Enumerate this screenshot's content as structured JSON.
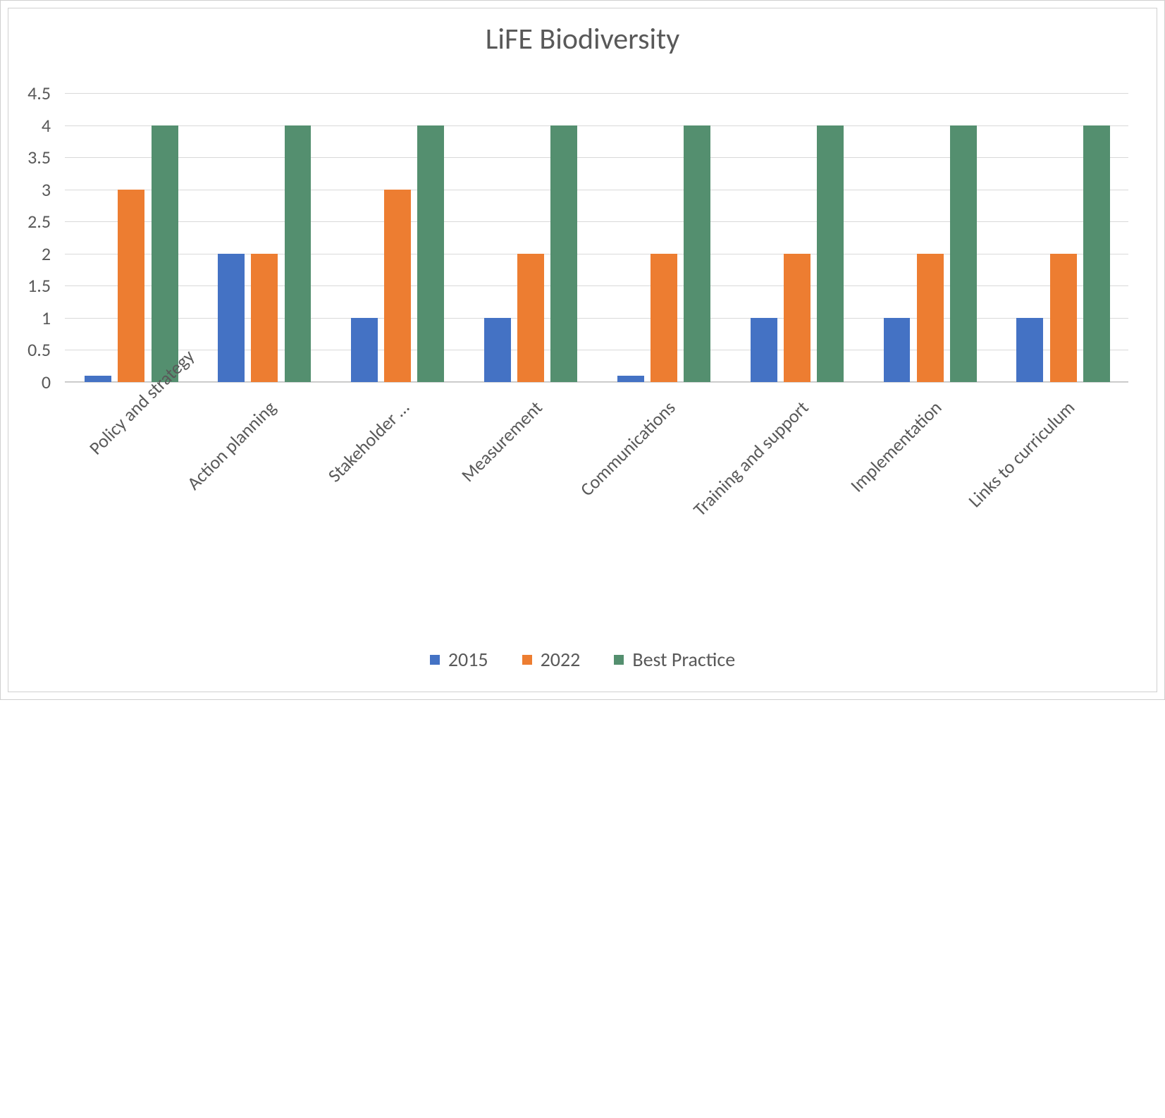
{
  "chart_data": {
    "type": "bar",
    "title": "LiFE Biodiversity",
    "xlabel": "",
    "ylabel": "",
    "ylim": [
      0,
      4.5
    ],
    "yticks": [
      0,
      0.5,
      1,
      1.5,
      2,
      2.5,
      3,
      3.5,
      4,
      4.5
    ],
    "categories": [
      "Policy and strategy",
      "Action planning",
      "Stakeholder …",
      "Measurement",
      "Communications",
      "Training and support",
      "Implementation",
      "Links to curriculum"
    ],
    "series": [
      {
        "name": "2015",
        "color": "#4472c4",
        "values": [
          0.1,
          2,
          1,
          1,
          0.1,
          1,
          1,
          1
        ]
      },
      {
        "name": "2022",
        "color": "#ed7d31",
        "values": [
          3,
          2,
          3,
          2,
          2,
          2,
          2,
          2
        ]
      },
      {
        "name": "Best Practice",
        "color": "#548f6f",
        "values": [
          4,
          4,
          4,
          4,
          4,
          4,
          4,
          4
        ]
      }
    ],
    "legend_position": "bottom",
    "grid": true
  }
}
